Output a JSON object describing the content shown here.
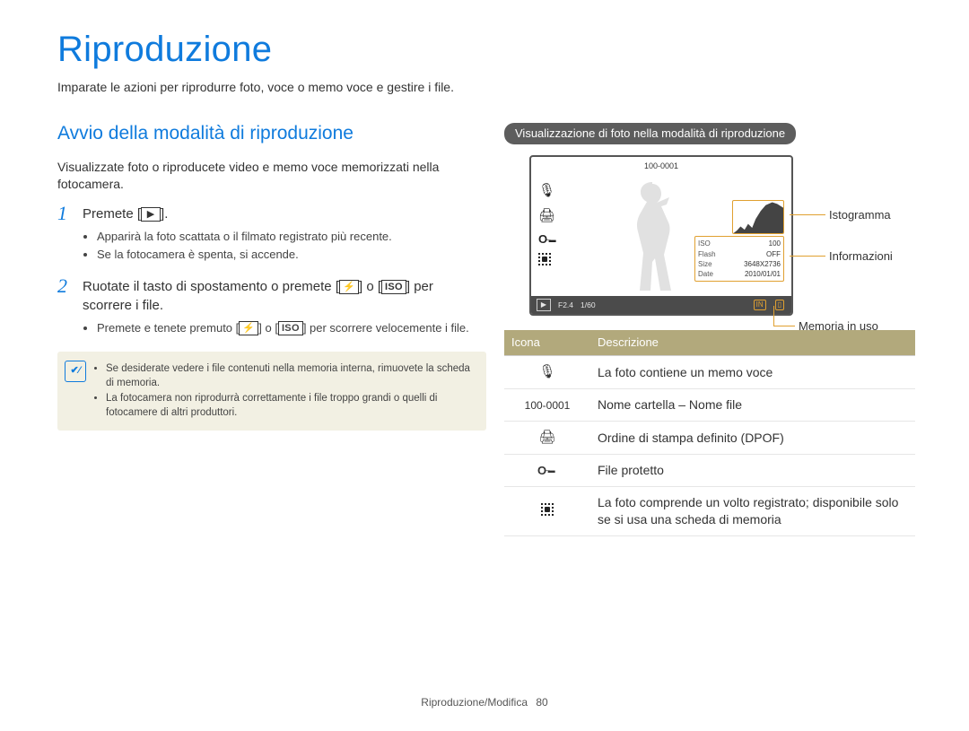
{
  "title": "Riproduzione",
  "intro": "Imparate le azioni per riprodurre foto, voce o memo voce e gestire i file.",
  "left": {
    "heading": "Avvio della modalità di riproduzione",
    "lead": "Visualizzate foto o riproducete video e memo voce memorizzati nella fotocamera.",
    "step1": {
      "num": "1",
      "text_a": "Premete [",
      "text_b": "].",
      "play_glyph": "▶",
      "b1": "Apparirà la foto scattata o il filmato registrato più recente.",
      "b2": "Se la fotocamera è spenta, si accende."
    },
    "step2": {
      "num": "2",
      "text_a": "Ruotate il tasto di spostamento o premete [",
      "text_b": "] o [",
      "text_c": "] per scorrere i file.",
      "flash_glyph": "⚡",
      "iso_glyph": "ISO",
      "b1_a": "Premete e tenete premuto [",
      "b1_b": "] o [",
      "b1_c": "] per scorrere velocemente i file."
    },
    "note": {
      "n1": "Se desiderate vedere i file contenuti nella memoria interna, rimuovete la scheda di memoria.",
      "n2": "La fotocamera non riprodurrà correttamente i file troppo grandi o quelli di fotocamere di altri produttori."
    }
  },
  "right": {
    "bar": "Visualizzazione di foto nella modalità di riproduzione",
    "screen": {
      "folder": "100-0001",
      "info": {
        "iso_l": "ISO",
        "iso_v": "100",
        "flash_l": "Flash",
        "flash_v": "OFF",
        "size_l": "Size",
        "size_v": "3648X2736",
        "date_l": "Date",
        "date_v": "2010/01/01"
      },
      "bottom": {
        "play": "▶",
        "fvalue": "F2.4",
        "shutter": "1/60",
        "mem1": "IN",
        "mem2": "▯"
      }
    },
    "callouts": {
      "histogram": "Istogramma",
      "info": "Informazioni",
      "memory": "Memoria in uso"
    },
    "table": {
      "h_icon": "Icona",
      "h_desc": "Descrizione",
      "rows": [
        {
          "icon": "mic",
          "key": "",
          "desc": "La foto contiene un memo voce"
        },
        {
          "icon": "text",
          "key": "100-0001",
          "desc": "Nome cartella – Nome file"
        },
        {
          "icon": "print",
          "key": "",
          "desc": "Ordine di stampa definito (DPOF)"
        },
        {
          "icon": "key",
          "key": "",
          "desc": "File protetto"
        },
        {
          "icon": "face",
          "key": "",
          "desc": "La foto comprende un volto registrato; disponibile solo se si usa una scheda di memoria"
        }
      ]
    }
  },
  "footer": {
    "section": "Riproduzione/Modifica",
    "page": "80"
  }
}
